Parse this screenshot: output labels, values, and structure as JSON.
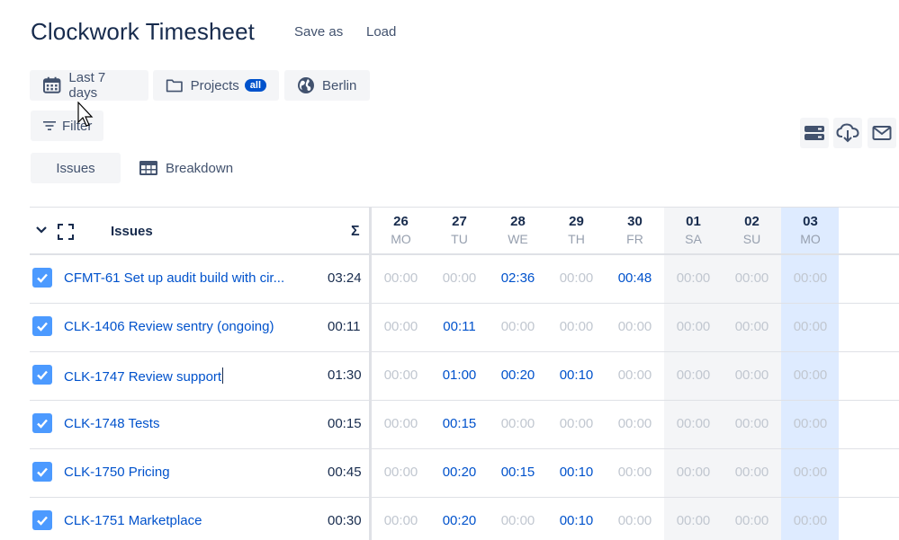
{
  "app": {
    "title": "Clockwork Timesheet",
    "save_as": "Save as",
    "load": "Load"
  },
  "filters": {
    "period": "Last 7 days",
    "projects": "Projects",
    "projects_badge": "all",
    "timezone": "Berlin",
    "filter": "Filter"
  },
  "views": {
    "issues": "Issues",
    "breakdown": "Breakdown"
  },
  "table": {
    "issues_header": "Issues",
    "sum_header": "Σ",
    "days": [
      {
        "num": "26",
        "name": "MO"
      },
      {
        "num": "27",
        "name": "TU"
      },
      {
        "num": "28",
        "name": "WE"
      },
      {
        "num": "29",
        "name": "TH"
      },
      {
        "num": "30",
        "name": "FR"
      },
      {
        "num": "01",
        "name": "SA"
      },
      {
        "num": "02",
        "name": "SU"
      },
      {
        "num": "03",
        "name": "MO"
      }
    ],
    "rows": [
      {
        "issue": "CFMT-61 Set up audit build with cir...",
        "total": "03:24",
        "cells": [
          "00:00",
          "00:00",
          "02:36",
          "00:00",
          "00:48",
          "00:00",
          "00:00",
          "00:00"
        ]
      },
      {
        "issue": "CLK-1406 Review sentry (ongoing)",
        "total": "00:11",
        "cells": [
          "00:00",
          "00:11",
          "00:00",
          "00:00",
          "00:00",
          "00:00",
          "00:00",
          "00:00"
        ]
      },
      {
        "issue": "CLK-1747 Review support",
        "total": "01:30",
        "cells": [
          "00:00",
          "01:00",
          "00:20",
          "00:10",
          "00:00",
          "00:00",
          "00:00",
          "00:00"
        ]
      },
      {
        "issue": "CLK-1748 Tests",
        "total": "00:15",
        "cells": [
          "00:00",
          "00:15",
          "00:00",
          "00:00",
          "00:00",
          "00:00",
          "00:00",
          "00:00"
        ]
      },
      {
        "issue": "CLK-1750 Pricing",
        "total": "00:45",
        "cells": [
          "00:00",
          "00:20",
          "00:15",
          "00:10",
          "00:00",
          "00:00",
          "00:00",
          "00:00"
        ]
      },
      {
        "issue": "CLK-1751 Marketplace",
        "total": "00:30",
        "cells": [
          "00:00",
          "00:20",
          "00:00",
          "00:10",
          "00:00",
          "00:00",
          "00:00",
          "00:00"
        ]
      }
    ]
  },
  "colors": {
    "link": "#0052cc",
    "empty": "#c1c7d0",
    "weekend": "#f4f5f7",
    "today": "#deebff",
    "checkbox": "#4c9aff"
  }
}
